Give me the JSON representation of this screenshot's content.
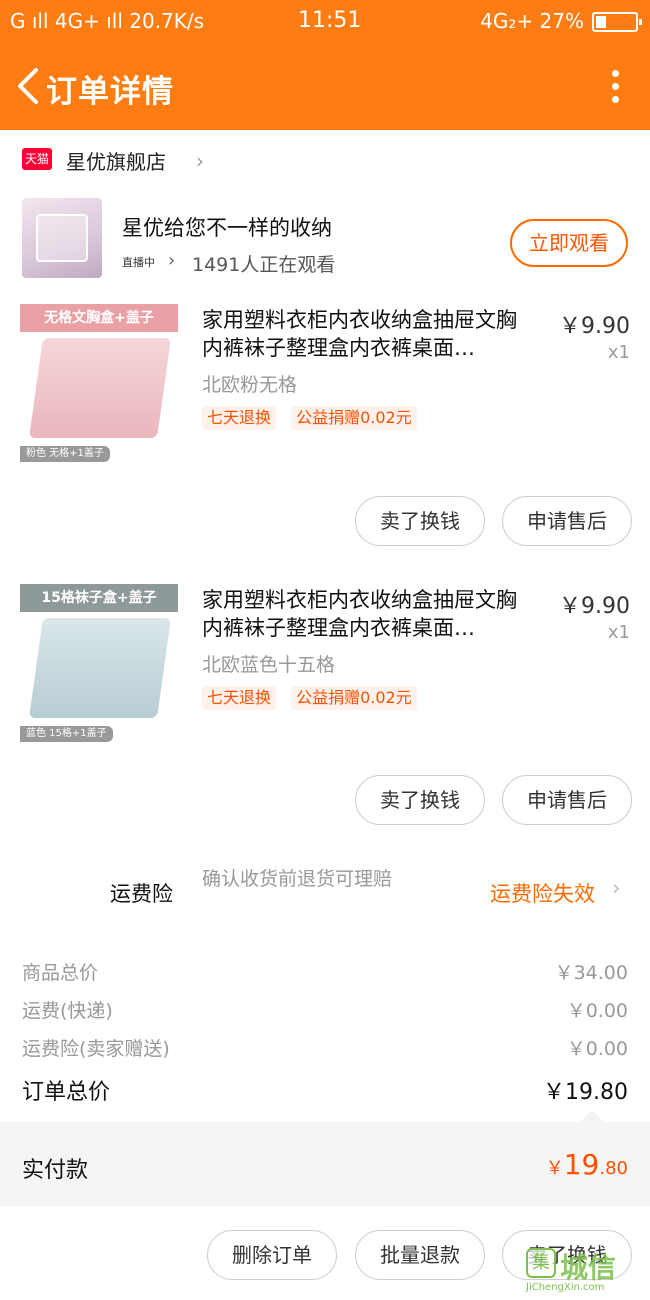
{
  "status_bar": {
    "left": "G ıll 4G+ ıll 20.7K/s",
    "time": "11:51",
    "right": "4G₂+ 27%",
    "battery_level": 0.27
  },
  "header": {
    "title": "订单详情"
  },
  "shop": {
    "badge": "天猫",
    "name": "星优旗舰店"
  },
  "live": {
    "title": "星优给您不一样的收纳",
    "badge": "直播中",
    "watching": "1491人正在观看",
    "watch_button": "立即观看"
  },
  "products": [
    {
      "image_tag": "无格文胸盒+盖子",
      "image_caption": "粉色 无格+1盖子",
      "name": "家用塑料衣柜内衣收纳盒抽屉文胸内裤袜子整理盒内衣裤桌面…",
      "price": "￥9.90",
      "qty": "x1",
      "sku": "北欧粉无格",
      "tags": [
        "七天退换",
        "公益捐赠0.02元"
      ],
      "sell_button": "卖了换钱",
      "after_sale_button": "申请售后"
    },
    {
      "image_tag": "15格袜子盒+盖子",
      "image_caption": "蓝色 15格+1盖子",
      "name": "家用塑料衣柜内衣收纳盒抽屉文胸内裤袜子整理盒内衣裤桌面…",
      "price": "￥9.90",
      "qty": "x1",
      "sku": "北欧蓝色十五格",
      "tags": [
        "七天退换",
        "公益捐赠0.02元"
      ],
      "sell_button": "卖了换钱",
      "after_sale_button": "申请售后"
    }
  ],
  "insurance": {
    "label": "运费险",
    "desc": "确认收货前退货可理赔",
    "status": "运费险失效"
  },
  "summary": {
    "goods_total_label": "商品总价",
    "goods_total": "￥34.00",
    "shipping_label": "运费(快递)",
    "shipping": "￥0.00",
    "insurance_label": "运费险(卖家赠送)",
    "insurance": "￥0.00",
    "order_total_label": "订单总价",
    "order_total": "￥19.80"
  },
  "paid": {
    "label": "实付款",
    "currency": "￥",
    "int": "19",
    "dec": ".80"
  },
  "bottom": {
    "delete_button": "删除订单",
    "batch_refund_button": "批量退款",
    "sell_button": "卖了换钱"
  },
  "watermark": {
    "logo": "集",
    "text": "城信",
    "url": "JiChengXin.com"
  }
}
